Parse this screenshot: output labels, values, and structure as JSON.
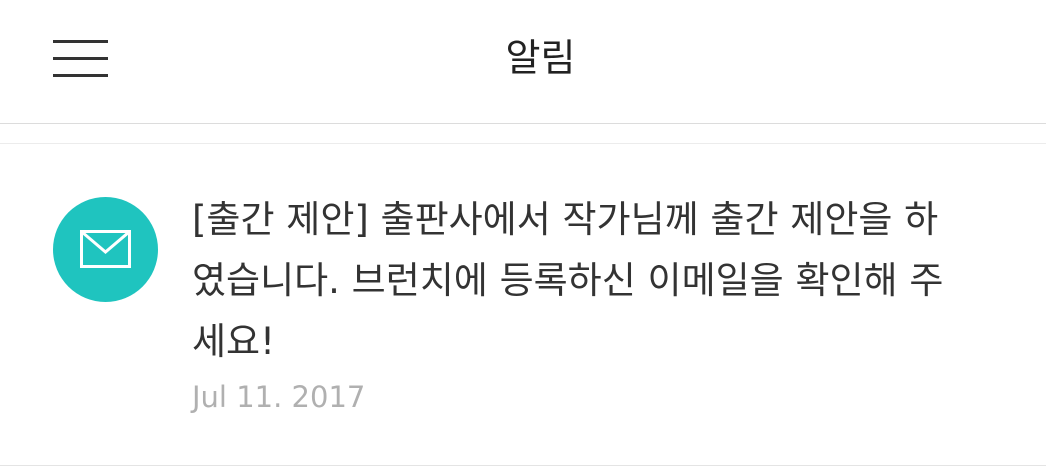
{
  "header": {
    "title": "알림",
    "menu_icon": "hamburger-menu-icon"
  },
  "notifications": [
    {
      "icon": "mail-icon",
      "icon_bg_color": "#1fc4bf",
      "message": "[출간 제안] 출판사에서 작가님께 출간 제안을 하였습니다. 브런치에 등록하신 이메일을 확인해 주세요!",
      "date": "Jul 11. 2017"
    }
  ]
}
